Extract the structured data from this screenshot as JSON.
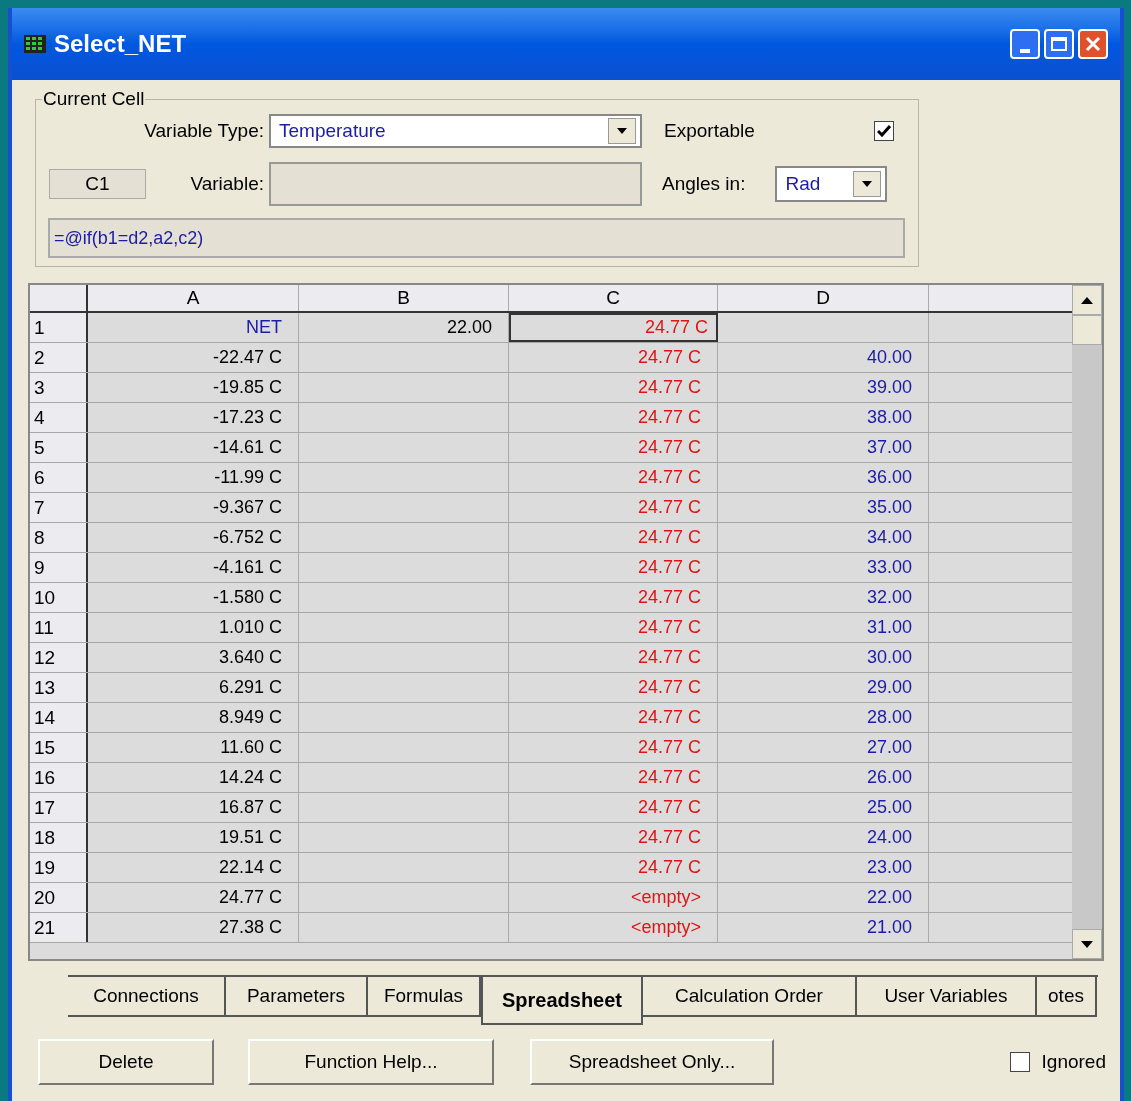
{
  "window": {
    "title": "Select_NET"
  },
  "current_cell": {
    "title": "Current Cell",
    "variable_type_label": "Variable Type:",
    "variable_type": "Temperature",
    "exportable_label": "Exportable",
    "exportable": true,
    "cell_ref": "C1",
    "variable_label": "Variable:",
    "angles_label": "Angles in:",
    "angles": "Rad",
    "formula": "=@if(b1=d2,a2,c2)"
  },
  "grid": {
    "columns": [
      "A",
      "B",
      "C",
      "D"
    ],
    "rows": [
      {
        "header": "1",
        "cells": [
          {
            "text": "NET",
            "color": "#1c1ca8",
            "selected": false
          },
          {
            "text": "22.00",
            "color": "#000000",
            "selected": false
          },
          {
            "text": "24.77 C",
            "color": "#dd1515",
            "selected": true
          },
          {
            "selected": false
          }
        ]
      },
      {
        "header": "2",
        "cells": [
          {
            "text": "-22.47 C",
            "color": "#000000",
            "selected": false
          },
          {
            "selected": false
          },
          {
            "text": "24.77 C",
            "color": "#dd1515",
            "selected": false
          },
          {
            "text": "40.00",
            "color": "#1c1ca8",
            "selected": false
          }
        ]
      },
      {
        "header": "3",
        "cells": [
          {
            "text": "-19.85 C",
            "color": "#000000",
            "selected": false
          },
          {
            "selected": false
          },
          {
            "text": "24.77 C",
            "color": "#dd1515",
            "selected": false
          },
          {
            "text": "39.00",
            "color": "#1c1ca8",
            "selected": false
          }
        ]
      },
      {
        "header": "4",
        "cells": [
          {
            "text": "-17.23 C",
            "color": "#000000",
            "selected": false
          },
          {
            "selected": false
          },
          {
            "text": "24.77 C",
            "color": "#dd1515",
            "selected": false
          },
          {
            "text": "38.00",
            "color": "#1c1ca8",
            "selected": false
          }
        ]
      },
      {
        "header": "5",
        "cells": [
          {
            "text": "-14.61 C",
            "color": "#000000",
            "selected": false
          },
          {
            "selected": false
          },
          {
            "text": "24.77 C",
            "color": "#dd1515",
            "selected": false
          },
          {
            "text": "37.00",
            "color": "#1c1ca8",
            "selected": false
          }
        ]
      },
      {
        "header": "6",
        "cells": [
          {
            "text": "-11.99 C",
            "color": "#000000",
            "selected": false
          },
          {
            "selected": false
          },
          {
            "text": "24.77 C",
            "color": "#dd1515",
            "selected": false
          },
          {
            "text": "36.00",
            "color": "#1c1ca8",
            "selected": false
          }
        ]
      },
      {
        "header": "7",
        "cells": [
          {
            "text": "-9.367 C",
            "color": "#000000",
            "selected": false
          },
          {
            "selected": false
          },
          {
            "text": "24.77 C",
            "color": "#dd1515",
            "selected": false
          },
          {
            "text": "35.00",
            "color": "#1c1ca8",
            "selected": false
          }
        ]
      },
      {
        "header": "8",
        "cells": [
          {
            "text": "-6.752 C",
            "color": "#000000",
            "selected": false
          },
          {
            "selected": false
          },
          {
            "text": "24.77 C",
            "color": "#dd1515",
            "selected": false
          },
          {
            "text": "34.00",
            "color": "#1c1ca8",
            "selected": false
          }
        ]
      },
      {
        "header": "9",
        "cells": [
          {
            "text": "-4.161 C",
            "color": "#000000",
            "selected": false
          },
          {
            "selected": false
          },
          {
            "text": "24.77 C",
            "color": "#dd1515",
            "selected": false
          },
          {
            "text": "33.00",
            "color": "#1c1ca8",
            "selected": false
          }
        ]
      },
      {
        "header": "10",
        "cells": [
          {
            "text": "-1.580 C",
            "color": "#000000",
            "selected": false
          },
          {
            "selected": false
          },
          {
            "text": "24.77 C",
            "color": "#dd1515",
            "selected": false
          },
          {
            "text": "32.00",
            "color": "#1c1ca8",
            "selected": false
          }
        ]
      },
      {
        "header": "11",
        "cells": [
          {
            "text": "1.010 C",
            "color": "#000000",
            "selected": false
          },
          {
            "selected": false
          },
          {
            "text": "24.77 C",
            "color": "#dd1515",
            "selected": false
          },
          {
            "text": "31.00",
            "color": "#1c1ca8",
            "selected": false
          }
        ]
      },
      {
        "header": "12",
        "cells": [
          {
            "text": "3.640 C",
            "color": "#000000",
            "selected": false
          },
          {
            "selected": false
          },
          {
            "text": "24.77 C",
            "color": "#dd1515",
            "selected": false
          },
          {
            "text": "30.00",
            "color": "#1c1ca8",
            "selected": false
          }
        ]
      },
      {
        "header": "13",
        "cells": [
          {
            "text": "6.291 C",
            "color": "#000000",
            "selected": false
          },
          {
            "selected": false
          },
          {
            "text": "24.77 C",
            "color": "#dd1515",
            "selected": false
          },
          {
            "text": "29.00",
            "color": "#1c1ca8",
            "selected": false
          }
        ]
      },
      {
        "header": "14",
        "cells": [
          {
            "text": "8.949 C",
            "color": "#000000",
            "selected": false
          },
          {
            "selected": false
          },
          {
            "text": "24.77 C",
            "color": "#dd1515",
            "selected": false
          },
          {
            "text": "28.00",
            "color": "#1c1ca8",
            "selected": false
          }
        ]
      },
      {
        "header": "15",
        "cells": [
          {
            "text": "11.60 C",
            "color": "#000000",
            "selected": false
          },
          {
            "selected": false
          },
          {
            "text": "24.77 C",
            "color": "#dd1515",
            "selected": false
          },
          {
            "text": "27.00",
            "color": "#1c1ca8",
            "selected": false
          }
        ]
      },
      {
        "header": "16",
        "cells": [
          {
            "text": "14.24 C",
            "color": "#000000",
            "selected": false
          },
          {
            "selected": false
          },
          {
            "text": "24.77 C",
            "color": "#dd1515",
            "selected": false
          },
          {
            "text": "26.00",
            "color": "#1c1ca8",
            "selected": false
          }
        ]
      },
      {
        "header": "17",
        "cells": [
          {
            "text": "16.87 C",
            "color": "#000000",
            "selected": false
          },
          {
            "selected": false
          },
          {
            "text": "24.77 C",
            "color": "#dd1515",
            "selected": false
          },
          {
            "text": "25.00",
            "color": "#1c1ca8",
            "selected": false
          }
        ]
      },
      {
        "header": "18",
        "cells": [
          {
            "text": "19.51 C",
            "color": "#000000",
            "selected": false
          },
          {
            "selected": false
          },
          {
            "text": "24.77 C",
            "color": "#dd1515",
            "selected": false
          },
          {
            "text": "24.00",
            "color": "#1c1ca8",
            "selected": false
          }
        ]
      },
      {
        "header": "19",
        "cells": [
          {
            "text": "22.14 C",
            "color": "#000000",
            "selected": false
          },
          {
            "selected": false
          },
          {
            "text": "24.77 C",
            "color": "#dd1515",
            "selected": false
          },
          {
            "text": "23.00",
            "color": "#1c1ca8",
            "selected": false
          }
        ]
      },
      {
        "header": "20",
        "cells": [
          {
            "text": "24.77 C",
            "color": "#000000",
            "selected": false
          },
          {
            "selected": false
          },
          {
            "text": "<empty>",
            "color": "#dd1515",
            "selected": false
          },
          {
            "text": "22.00",
            "color": "#1c1ca8",
            "selected": false
          }
        ]
      },
      {
        "header": "21",
        "cells": [
          {
            "text": "27.38 C",
            "color": "#000000",
            "selected": false
          },
          {
            "selected": false
          },
          {
            "text": "<empty>",
            "color": "#dd1515",
            "selected": false
          },
          {
            "text": "21.00",
            "color": "#1c1ca8",
            "selected": false
          }
        ]
      }
    ]
  },
  "tabs": [
    {
      "label": "Connections",
      "selected": false
    },
    {
      "label": "Parameters",
      "selected": false
    },
    {
      "label": "Formulas",
      "selected": false
    },
    {
      "label": "Spreadsheet",
      "selected": true
    },
    {
      "label": "Calculation Order",
      "selected": false
    },
    {
      "label": "User Variables",
      "selected": false
    },
    {
      "label": "otes",
      "selected": false
    }
  ],
  "buttons": [
    "Delete",
    "Function Help...",
    "Spreadsheet Only..."
  ],
  "ignored": {
    "label": "Ignored",
    "checked": false
  }
}
